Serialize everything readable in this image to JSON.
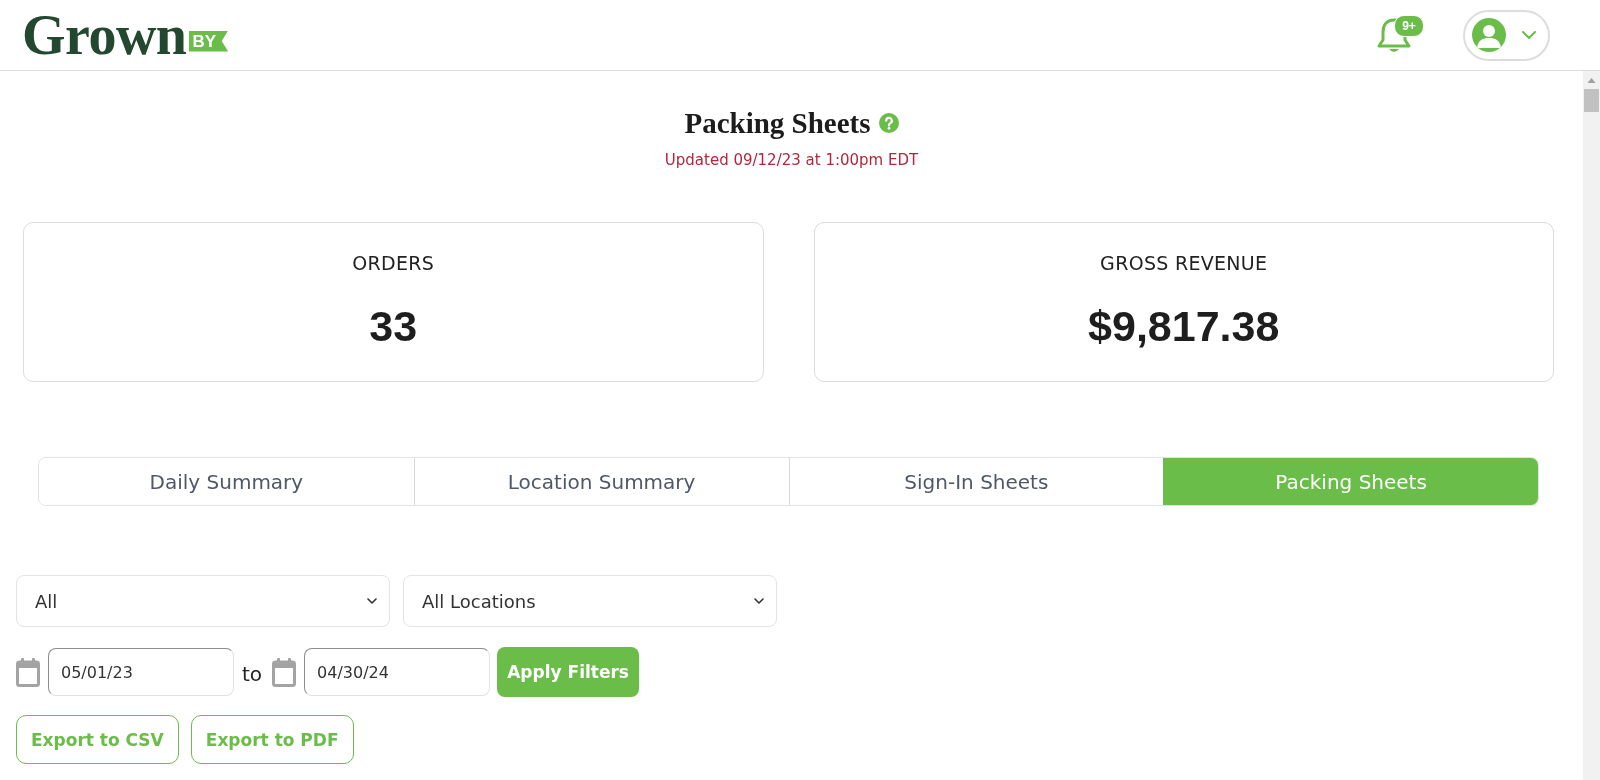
{
  "header": {
    "logo": {
      "wordmark": "Grown",
      "flag": "BY"
    },
    "notifications": {
      "count": "9+"
    }
  },
  "page": {
    "title": "Packing Sheets",
    "updated": "Updated 09/12/23 at 1:00pm EDT"
  },
  "stats": [
    {
      "label": "ORDERS",
      "value": "33"
    },
    {
      "label": "GROSS REVENUE",
      "value": "$9,817.38"
    }
  ],
  "tabs": [
    {
      "label": "Daily Summary",
      "selected": false
    },
    {
      "label": "Location Summary",
      "selected": false
    },
    {
      "label": "Sign-In Sheets",
      "selected": false
    },
    {
      "label": "Packing Sheets",
      "selected": true
    }
  ],
  "filters": {
    "selects": [
      {
        "value": "All"
      },
      {
        "value": "All Locations"
      }
    ],
    "date_from": "05/01/23",
    "to_label": "to",
    "date_to": "04/30/24",
    "apply_button": "Apply Filters"
  },
  "export_buttons": [
    "Export to CSV",
    "Export to PDF"
  ]
}
